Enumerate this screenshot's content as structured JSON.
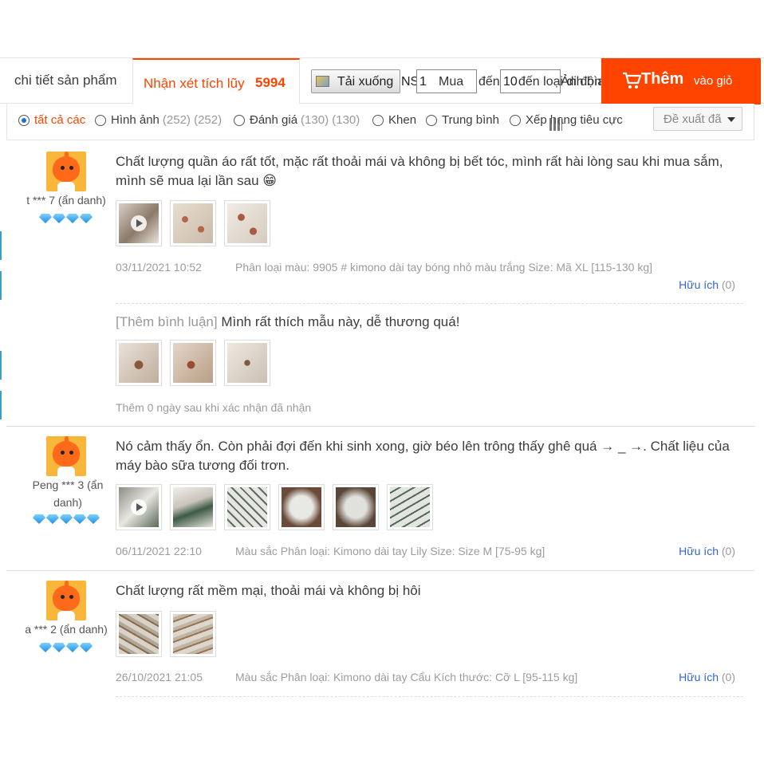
{
  "tabs": {
    "detail_label": "chi tiết sản phẩm",
    "reviews_label": "Nhận xét tích lũy",
    "reviews_count": "5994"
  },
  "toolbar": {
    "download_label": "Tải xuống",
    "ns_label": "NS",
    "input1_value": "1",
    "overlay1": "Mua",
    "overlay2": "đến",
    "input2_value": "10",
    "overlay3": "đến loại di động",
    "overlay4": "Ảnh bìa"
  },
  "cart_button": {
    "label_big": "Thêm",
    "label_small": "vào giỏ",
    "color": "#ff4400"
  },
  "filter": {
    "options": [
      {
        "label": "tất cả các",
        "count": "",
        "selected": true
      },
      {
        "label": "Hình ảnh",
        "count": "(252) (252)",
        "selected": false
      },
      {
        "label": "Đánh giá",
        "count": "(130) (130)",
        "selected": false
      },
      {
        "label": "Khen",
        "count": "",
        "selected": false
      },
      {
        "label": "Trung bình",
        "count": "",
        "selected": false
      },
      {
        "label": "Xếp hạng tiêu cực",
        "count": "",
        "selected": false
      }
    ],
    "sort_label": "Đề xuất đã"
  },
  "reviews": [
    {
      "user": "t *** 7 (ẩn danh)",
      "gems": 4,
      "text": "Chất lượng quần áo rất tốt, mặc rất thoải mái và không bị bết tóc, mình rất hài lòng sau khi mua sắm, mình sẽ mua lại lần sau 😁",
      "date": "03/11/2021 10:52",
      "variant": "Phân loại màu: 9905 # kimono dài tay bóng nhỏ màu trắng Size: Mã XL [115-130 kg]",
      "useful": "Hữu ích",
      "useful_count": "(0)",
      "followup_label": "[Thêm bình luận]",
      "followup_text": "Mình rất thích mẫu này, dễ thương quá!",
      "followup_note": "Thêm 0 ngày sau khi xác nhận đã nhận"
    },
    {
      "user": "Peng *** 3 (ẩn danh)",
      "gems": 5,
      "text": "Nó cảm thấy ổn. Còn phải đợi đến khi sinh xong, giờ béo lên trông thấy ghê quá → _ →. Chất liệu của máy bào sữa tương đối trơn.",
      "date": "06/11/2021 22:10",
      "variant": "Màu sắc Phân loại: Kimono dài tay Lily Size: Size M [75-95 kg]",
      "useful": "Hữu ích",
      "useful_count": "(0)"
    },
    {
      "user": "a *** 2 (ẩn danh)",
      "gems": 4,
      "text": "Chất lượng rất mềm mại, thoải mái và không bị hôi",
      "date": "26/10/2021 21:05",
      "variant": "Màu sắc Phân loại: Kimono dài tay Cẩu Kích thước: Cỡ L [95-115 kg]",
      "useful": "Hữu ích",
      "useful_count": "(0)"
    }
  ],
  "colors": {
    "accent": "#ff4400",
    "link": "#3366cc",
    "muted": "#9c9c9c"
  }
}
